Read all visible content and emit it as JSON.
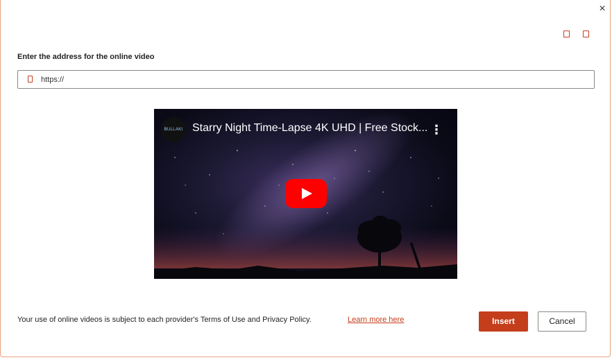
{
  "dialog": {
    "close_label": "×",
    "prompt": "Enter the address for the online video",
    "url": {
      "value": "https://",
      "icon": "link-icon"
    },
    "header_icons": [
      "placeholder-icon",
      "placeholder-icon"
    ],
    "video": {
      "channel": "BULLAKI",
      "title": "Starry Night Time-Lapse 4K UHD | Free Stock...",
      "more_icon": "⋮"
    },
    "footer_text": "Your use of online videos is subject to each provider's Terms of Use and Privacy Policy.",
    "learn_more": "Learn more here",
    "insert_label": "Insert",
    "cancel_label": "Cancel",
    "colors": {
      "accent": "#c43e1c",
      "youtube_red": "#ff0000"
    }
  }
}
